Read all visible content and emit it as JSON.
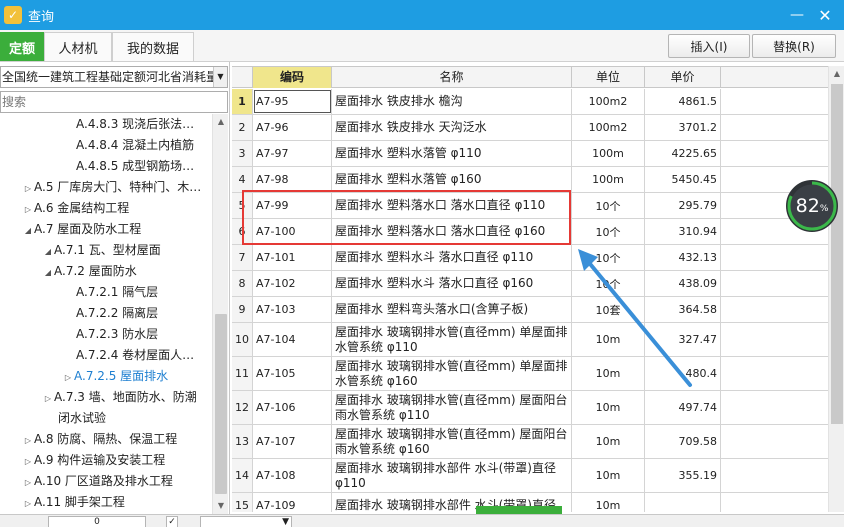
{
  "window": {
    "title": "查询",
    "minimize": "—",
    "close": "✕",
    "app_icon": "app-logo-icon"
  },
  "tabs": [
    {
      "label": "定额",
      "active": true
    },
    {
      "label": "人材机",
      "active": false
    },
    {
      "label": "我的数据",
      "active": false
    }
  ],
  "toolbar": {
    "insert_label": "插入(I)",
    "replace_label": "替换(R)"
  },
  "left": {
    "library": "全国统一建筑工程基础定额河北省消耗量",
    "search_placeholder": "搜索",
    "tree": [
      {
        "label": "A.4.8.3 现浇后张法…",
        "indent": 76,
        "tri": ""
      },
      {
        "label": "A.4.8.4 混凝土内植筋",
        "indent": 76,
        "tri": ""
      },
      {
        "label": "A.4.8.5 成型钢筋场…",
        "indent": 76,
        "tri": ""
      },
      {
        "label": "A.5 厂库房大门、特种门、木…",
        "indent": 22,
        "tri": "▷"
      },
      {
        "label": "A.6 金属结构工程",
        "indent": 22,
        "tri": "▷"
      },
      {
        "label": "A.7 屋面及防水工程",
        "indent": 22,
        "tri": "◢"
      },
      {
        "label": "A.7.1 瓦、型材屋面",
        "indent": 42,
        "tri": "◢"
      },
      {
        "label": "A.7.2 屋面防水",
        "indent": 42,
        "tri": "◢"
      },
      {
        "label": "A.7.2.1 隔气层",
        "indent": 76,
        "tri": ""
      },
      {
        "label": "A.7.2.2 隔离层",
        "indent": 76,
        "tri": ""
      },
      {
        "label": "A.7.2.3 防水层",
        "indent": 76,
        "tri": ""
      },
      {
        "label": "A.7.2.4 卷材屋面人…",
        "indent": 76,
        "tri": ""
      },
      {
        "label": "A.7.2.5 屋面排水",
        "indent": 62,
        "tri": "▷",
        "selected": true
      },
      {
        "label": "A.7.3 墙、地面防水、防潮",
        "indent": 42,
        "tri": "▷"
      },
      {
        "label": "闭水试验",
        "indent": 58,
        "tri": ""
      },
      {
        "label": "A.8 防腐、隔热、保温工程",
        "indent": 22,
        "tri": "▷"
      },
      {
        "label": "A.9 构件运输及安装工程",
        "indent": 22,
        "tri": "▷"
      },
      {
        "label": "A.10 厂区道路及排水工程",
        "indent": 22,
        "tri": "▷"
      },
      {
        "label": "A.11 脚手架工程",
        "indent": 22,
        "tri": "▷"
      }
    ]
  },
  "table": {
    "headers": {
      "code": "编码",
      "name": "名称",
      "unit": "单位",
      "price": "单价"
    },
    "rows": [
      {
        "idx": "1",
        "code": "A7-95",
        "name": "屋面排水 铁皮排水 檐沟",
        "unit": "100m2",
        "price": "4861.5"
      },
      {
        "idx": "2",
        "code": "A7-96",
        "name": "屋面排水 铁皮排水 天沟泛水",
        "unit": "100m2",
        "price": "3701.2"
      },
      {
        "idx": "3",
        "code": "A7-97",
        "name": "屋面排水 塑料水落管 φ110",
        "unit": "100m",
        "price": "4225.65"
      },
      {
        "idx": "4",
        "code": "A7-98",
        "name": "屋面排水 塑料水落管 φ160",
        "unit": "100m",
        "price": "5450.45"
      },
      {
        "idx": "5",
        "code": "A7-99",
        "name": "屋面排水 塑料落水口 落水口直径 φ110",
        "unit": "10个",
        "price": "295.79"
      },
      {
        "idx": "6",
        "code": "A7-100",
        "name": "屋面排水 塑料落水口 落水口直径 φ160",
        "unit": "10个",
        "price": "310.94"
      },
      {
        "idx": "7",
        "code": "A7-101",
        "name": "屋面排水 塑料水斗 落水口直径 φ110",
        "unit": "10个",
        "price": "432.13"
      },
      {
        "idx": "8",
        "code": "A7-102",
        "name": "屋面排水 塑料水斗 落水口直径 φ160",
        "unit": "10个",
        "price": "438.09"
      },
      {
        "idx": "9",
        "code": "A7-103",
        "name": "屋面排水 塑料弯头落水口(含箅子板)",
        "unit": "10套",
        "price": "364.58"
      },
      {
        "idx": "10",
        "code": "A7-104",
        "name": "屋面排水 玻璃钢排水管(直径mm) 单屋面排水管系统 φ110",
        "unit": "10m",
        "price": "327.47"
      },
      {
        "idx": "11",
        "code": "A7-105",
        "name": "屋面排水 玻璃钢排水管(直径mm) 单屋面排水管系统 φ160",
        "unit": "10m",
        "price": "480.4"
      },
      {
        "idx": "12",
        "code": "A7-106",
        "name": "屋面排水 玻璃钢排水管(直径mm) 屋面阳台雨水管系统 φ110",
        "unit": "10m",
        "price": "497.74"
      },
      {
        "idx": "13",
        "code": "A7-107",
        "name": "屋面排水 玻璃钢排水管(直径mm) 屋面阳台雨水管系统 φ160",
        "unit": "10m",
        "price": "709.58"
      },
      {
        "idx": "14",
        "code": "A7-108",
        "name": "屋面排水 玻璃钢排水部件 水斗(带罩)直径 φ110",
        "unit": "10m",
        "price": "355.19"
      },
      {
        "idx": "15",
        "code": "A7-109",
        "name": "屋面排水 玻璃钢排水部件 水斗(带罩)直径",
        "unit": "10m",
        "price": ""
      }
    ]
  },
  "gauge": {
    "value": "82",
    "unit": "%",
    "percent": 82,
    "color": "#3bb84a"
  },
  "highlight_color": "#e53935",
  "arrow_color": "#3a8fd8",
  "bottom": {
    "count": "0"
  }
}
